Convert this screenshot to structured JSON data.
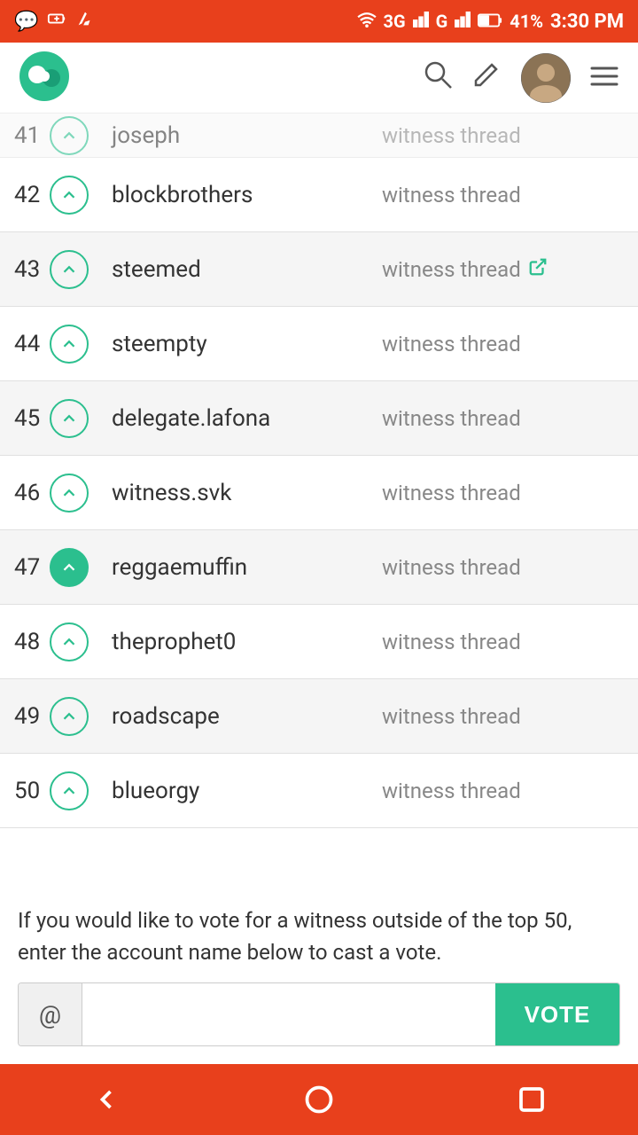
{
  "statusBar": {
    "network": "3G",
    "carrier": "G",
    "battery": "41%",
    "time": "3:30 PM"
  },
  "toolbar": {
    "searchLabel": "search",
    "menuLabel": "menu"
  },
  "partialRow": {
    "rank": "41",
    "name": "joseph",
    "thread": "witness thread"
  },
  "witnesses": [
    {
      "rank": "42",
      "name": "blockbrothers",
      "thread": "witness thread",
      "active": false,
      "external": false
    },
    {
      "rank": "43",
      "name": "steemed",
      "thread": "witness thread",
      "active": false,
      "external": true
    },
    {
      "rank": "44",
      "name": "steempty",
      "thread": "witness thread",
      "active": false,
      "external": false
    },
    {
      "rank": "45",
      "name": "delegate.lafona",
      "thread": "witness thread",
      "active": false,
      "external": false
    },
    {
      "rank": "46",
      "name": "witness.svk",
      "thread": "witness thread",
      "active": false,
      "external": false
    },
    {
      "rank": "47",
      "name": "reggaemuffin",
      "thread": "witness thread",
      "active": true,
      "external": false
    },
    {
      "rank": "48",
      "name": "theprophet0",
      "thread": "witness thread",
      "active": false,
      "external": false
    },
    {
      "rank": "49",
      "name": "roadscape",
      "thread": "witness thread",
      "active": false,
      "external": false
    },
    {
      "rank": "50",
      "name": "blueorgy",
      "thread": "witness thread",
      "active": false,
      "external": false
    }
  ],
  "footerText": "If you would like to vote for a witness outside of the top 50, enter the account name below to cast a vote.",
  "voteInput": {
    "atSymbol": "@",
    "placeholder": "",
    "buttonLabel": "VOTE"
  }
}
